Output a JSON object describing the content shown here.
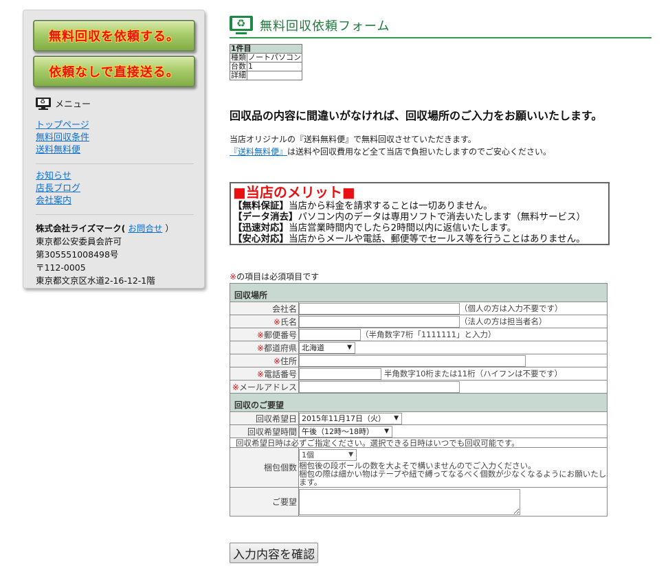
{
  "sidebar": {
    "btn_request": "無料回収を依頼する。",
    "btn_direct": "依頼なしで直接送る。",
    "menu_label": "メニュー",
    "links_primary": [
      "トップページ",
      "無料回収条件",
      "送料無料便"
    ],
    "links_secondary": [
      "お知らせ",
      "店長ブログ",
      "会社案内"
    ],
    "company": {
      "name": "株式会社ライズマーク(",
      "contact_link": "お問合せ",
      "close_paren": "）",
      "license": "東京都公安委員会許可",
      "license_no": "第305551008498号",
      "zip": "〒112-0005",
      "address": "東京都文京区水道2-16-12-1階"
    }
  },
  "header": {
    "title": "無料回収依頼フォーム"
  },
  "items": {
    "header": "1件目",
    "rows": [
      {
        "label": "種類",
        "value": "ノートパソコン"
      },
      {
        "label": "台数",
        "value": "1"
      },
      {
        "label": "詳細",
        "value": ""
      }
    ]
  },
  "confirm_message": "回収品の内容に間違いがなければ、回収場所のご入力をお願いいたします。",
  "notice": {
    "line1": "当店オリジナルの『送料無料便』で無料回収させていただきます。",
    "link": "『送料無料便』",
    "line2": "は送料や回収費用など全て当店で負担いたしますのでご安心ください。"
  },
  "merit": {
    "title": "■当店のメリット■",
    "items": [
      {
        "tag": "【無料保証】",
        "text": "当店から料金を請求することは一切ありません。"
      },
      {
        "tag": "【データ消去】",
        "text": "パソコン内のデータは専用ソフトで消去いたします（無料サービス）"
      },
      {
        "tag": "【迅速対応】",
        "text": "当店営業時間内でしたら2時間以内に返信いたします。"
      },
      {
        "tag": "【安心対応】",
        "text": "当店からメールや電話、郵便等でセールス等を行うことはありません。"
      }
    ]
  },
  "form": {
    "required_mark": "※",
    "required_note": "の項目は必須項目です",
    "section_place": "回収場所",
    "company_label": "会社名",
    "company_hint": "（個人の方は入力不要です）",
    "name_label": "氏名",
    "name_hint": "（法人の方は担当者名）",
    "zip_label": "郵便番号",
    "zip_hint": "（半角数字7桁「1111111」と入力）",
    "pref_label": "都道府県",
    "pref_value": "北海道",
    "address_label": "住所",
    "phone_label": "電話番号",
    "phone_hint": "半角数字10桁または11桁（ハイフンは不要です）",
    "email_label": "メールアドレス",
    "section_wish": "回収のご要望",
    "date_label": "回収希望日",
    "date_value": "2015年11月17日（火）",
    "time_label": "回収希望時間",
    "time_value": "午後（12時～18時）",
    "date_note": "回収希望日時は必ずご指定ください。選択できる日時はいつでも回収可能です。",
    "box_label": "梱包個数",
    "box_value": "1個",
    "box_note1": "梱包後の段ボールの数を大よそで構いませんのでご入力ください。",
    "box_note2": "梱包の際は細かい物はテープや紐で縛ってなるべく個数が少なくなるようにお願いたします。",
    "request_label": "ご要望",
    "submit": "入力内容を確認"
  }
}
